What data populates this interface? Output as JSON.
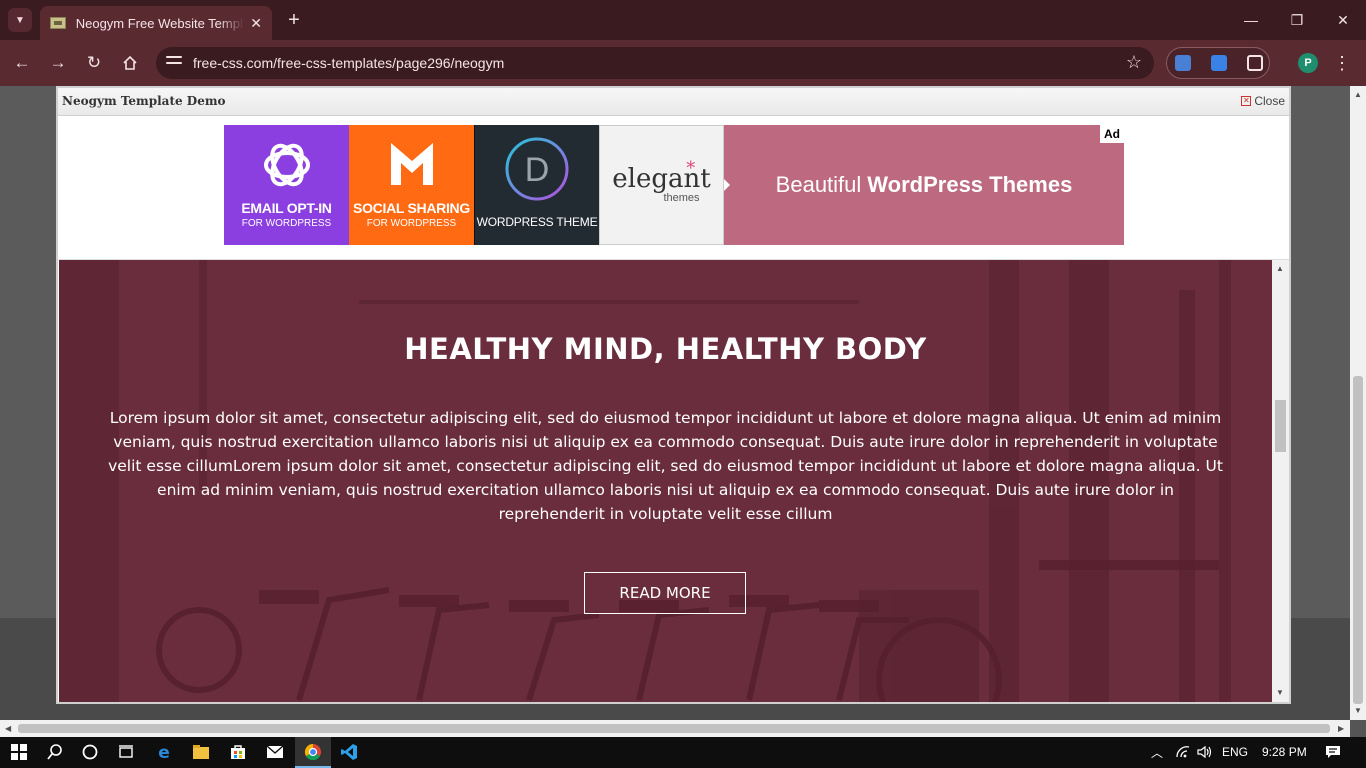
{
  "browser": {
    "tab_title": "Neogym Free Website Template",
    "url": "free-css.com/free-css-templates/page296/neogym",
    "profile_initial": "P"
  },
  "modal": {
    "title": "Neogym Template Demo",
    "close_label": "Close"
  },
  "ad": {
    "tile1_line1": "EMAIL OPT-IN",
    "tile1_line2": "FOR WORDPRESS",
    "tile2_line1": "SOCIAL SHARING",
    "tile2_line2": "FOR WORDPRESS",
    "tile3_line1": "WORDPRESS THEME",
    "tile4_brand": "elegant",
    "tile4_sub": "themes",
    "main_prefix": "Beautiful",
    "main_bold": "WordPress Themes",
    "badge": "Ad",
    "colors": {
      "tile1": "#8b3fe0",
      "tile2": "#ff6a13",
      "main": "#bd6980"
    }
  },
  "hero": {
    "title": "HEALTHY MIND, HEALTHY BODY",
    "body": "Lorem ipsum dolor sit amet, consectetur adipiscing elit, sed do eiusmod tempor incididunt ut labore et dolore magna aliqua. Ut enim ad minim veniam, quis nostrud exercitation ullamco laboris nisi ut aliquip ex ea commodo consequat. Duis aute irure dolor in reprehenderit in voluptate velit esse cillumLorem ipsum dolor sit amet, consectetur adipiscing elit, sed do eiusmod tempor incididunt ut labore et dolore magna aliqua. Ut enim ad minim veniam, quis nostrud exercitation ullamco laboris nisi ut aliquip ex ea commodo consequat. Duis aute irure dolor in reprehenderit in voluptate velit esse cillum",
    "button": "READ MORE",
    "overlay_color": "#6a2d3e"
  },
  "taskbar": {
    "language": "ENG",
    "time": "9:28 PM"
  }
}
